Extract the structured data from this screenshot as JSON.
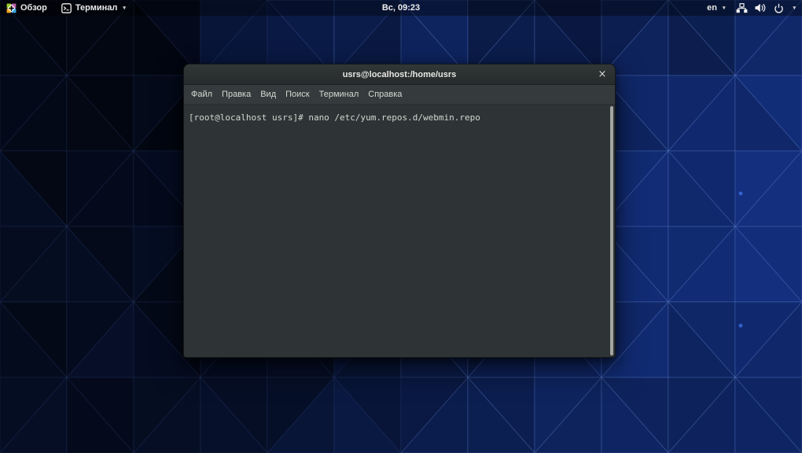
{
  "top_bar": {
    "activities": {
      "label": "Обзор"
    },
    "app_menu": {
      "label": "Терминал"
    },
    "clock": "Вс, 09:23",
    "system": {
      "keyboard_layout": "en"
    }
  },
  "icons": {
    "caret": "▾",
    "close": "×",
    "distro_logo": "centos-pinwheel",
    "terminal_app": "terminal-prompt-square",
    "network": "wired-network",
    "volume": "speaker-loud",
    "power": "power-symbol"
  },
  "window": {
    "title": "usrs@localhost:/home/usrs",
    "menu": [
      "Файл",
      "Правка",
      "Вид",
      "Поиск",
      "Терминал",
      "Справка"
    ],
    "terminal": {
      "line": "[root@localhost usrs]# nano /etc/yum.repos.d/webmin.repo"
    }
  },
  "theme": {
    "wallpaper_dark": "#050a1e",
    "wallpaper_bright": "#1a3a8f",
    "panel_bg": "rgba(0,0,0,0.38)",
    "titlebar_bg": "#2c3030",
    "menubar_bg": "#353b3c",
    "terminal_bg": "#2e3436",
    "terminal_fg": "#d3d7cf",
    "scrollbar_thumb": "#a4a6a2"
  }
}
